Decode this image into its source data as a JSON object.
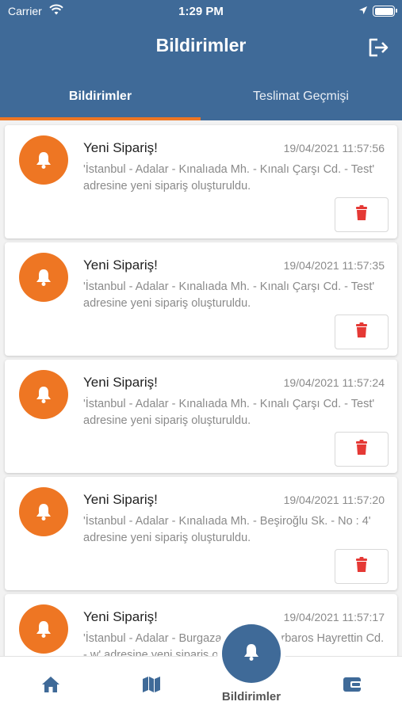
{
  "status_bar": {
    "carrier": "Carrier",
    "time": "1:29 PM"
  },
  "header": {
    "title": "Bildirimler",
    "logout_icon": "logout-icon"
  },
  "tabs": [
    {
      "label": "Bildirimler",
      "active": true
    },
    {
      "label": "Teslimat Geçmişi",
      "active": false
    }
  ],
  "colors": {
    "primary": "#3f6a98",
    "accent": "#ee7623",
    "delete": "#e53935"
  },
  "notifications": [
    {
      "title": "Yeni Sipariş!",
      "date": "19/04/2021 11:57:56",
      "message": "'İstanbul - Adalar - Kınalıada Mh. - Kınalı Çarşı Cd. - Test' adresine yeni sipariş oluşturuldu."
    },
    {
      "title": "Yeni Sipariş!",
      "date": "19/04/2021 11:57:35",
      "message": "'İstanbul - Adalar - Kınalıada Mh. - Kınalı Çarşı Cd. - Test' adresine yeni sipariş oluşturuldu."
    },
    {
      "title": "Yeni Sipariş!",
      "date": "19/04/2021 11:57:24",
      "message": "'İstanbul - Adalar - Kınalıada Mh. - Kınalı Çarşı Cd. - Test' adresine yeni sipariş oluşturuldu."
    },
    {
      "title": "Yeni Sipariş!",
      "date": "19/04/2021 11:57:20",
      "message": "'İstanbul - Adalar - Kınalıada Mh. - Beşiroğlu Sk. - No : 4' adresine yeni sipariş oluşturuldu."
    },
    {
      "title": "Yeni Sipariş!",
      "date": "19/04/2021 11:57:17",
      "message": "'İstanbul - Adalar - Burgazada Mh. - Barbaros Hayrettin Cd. - w' adresine yeni sipariş oluşturuldu."
    }
  ],
  "bottom_nav": {
    "items": [
      {
        "icon": "home-icon"
      },
      {
        "icon": "map-icon"
      },
      {
        "icon": "bell-icon",
        "label": "Bildirimler",
        "active": true
      },
      {
        "icon": "wallet-icon"
      }
    ]
  }
}
